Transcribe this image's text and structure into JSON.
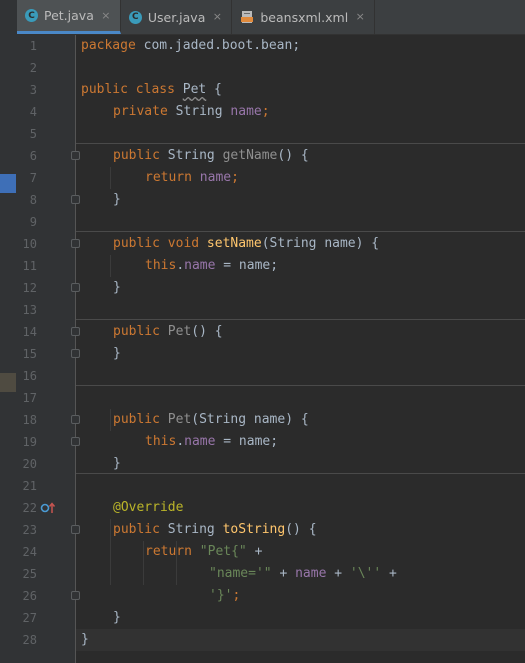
{
  "tabs": [
    {
      "label": "Pet.java",
      "icon": "class-icon",
      "active": true
    },
    {
      "label": "User.java",
      "icon": "class-icon",
      "active": false
    },
    {
      "label": "beansxml.xml",
      "icon": "xml-file-icon",
      "active": false
    }
  ],
  "tab_icon_letter": "C",
  "close_glyph": "×",
  "line_numbers": [
    "1",
    "2",
    "3",
    "4",
    "5",
    "6",
    "7",
    "8",
    "9",
    "10",
    "11",
    "12",
    "13",
    "14",
    "15",
    "16",
    "17",
    "18",
    "19",
    "20",
    "21",
    "22",
    "23",
    "24",
    "25",
    "26",
    "27",
    "28"
  ],
  "code": {
    "l1": {
      "kw": "package",
      "rest": " com.jaded.boot.bean;"
    },
    "l3": {
      "kw": "public class",
      "name": "Pet",
      "rest": " {"
    },
    "l4": {
      "kw": "private",
      "type": " String ",
      "field": "name",
      "end": ";"
    },
    "l6": {
      "kw": "public",
      "type": " String ",
      "method": "getName",
      "end": "() {"
    },
    "l7": {
      "kw": "return",
      "field": "name",
      "end": ";"
    },
    "l8": {
      "text": "}"
    },
    "l10": {
      "kw": "public void",
      "method": "setName",
      "end": "(String name) {"
    },
    "l11": {
      "kw": "this",
      "dot": ".",
      "field": "name",
      "end": " = name;"
    },
    "l12": {
      "text": "}"
    },
    "l14": {
      "kw": "public",
      "ctor": "Pet",
      "end": "() {"
    },
    "l15": {
      "text": "}"
    },
    "l17": {
      "kw": "public",
      "ctor": "Pet",
      "end": "(String name) {"
    },
    "l18": {
      "kw": "this",
      "dot": ".",
      "field": "name",
      "end": " = name;"
    },
    "l19": {
      "text": "}"
    },
    "l21": {
      "annotation": "@Override"
    },
    "l22": {
      "kw": "public",
      "type": " String ",
      "method": "toString",
      "end": "() {"
    },
    "l23": {
      "kw": "return",
      "str": "\"Pet{\"",
      "end": " +"
    },
    "l24": {
      "str1": "\"name='\"",
      "mid": " + ",
      "field": "name",
      "mid2": " + ",
      "str2": "'\\''",
      "end": " +"
    },
    "l25": {
      "str": "'}'",
      "end": ";"
    },
    "l26": {
      "text": "}"
    },
    "l27": {
      "text": "}"
    }
  },
  "colors": {
    "background": "#2b2b2b",
    "keyword": "#cc7832",
    "method": "#ffc66d",
    "field": "#9876aa",
    "string": "#6a8759",
    "annotation": "#bbb529",
    "plain": "#a9b7c6",
    "tab_accent": "#4a88c7"
  }
}
